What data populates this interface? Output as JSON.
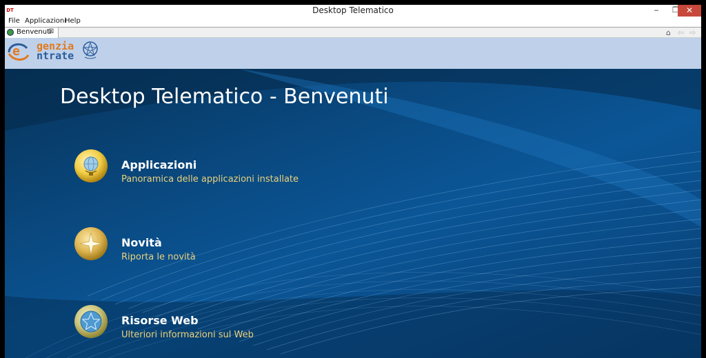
{
  "window": {
    "app_icon": "DT",
    "title": "Desktop Telematico",
    "minimize_icon": "minimize-icon",
    "maximize_icon": "restore-icon",
    "close_icon": "close-icon"
  },
  "menu": {
    "items": [
      "File",
      "Applicazioni",
      "Help"
    ]
  },
  "tab": {
    "label": "Benvenuti",
    "close_glyph": "⊠"
  },
  "nav": {
    "home_icon": "home-icon",
    "back_icon": "back-arrow-icon",
    "forward_icon": "forward-arrow-icon"
  },
  "logo": {
    "line1": "genzia",
    "line2": "ntrate",
    "brand_color": "#e2791e",
    "secondary_color": "#2c5d9b"
  },
  "page": {
    "title": "Desktop Telematico - Benvenuti"
  },
  "entries": [
    {
      "title": "Applicazioni",
      "description": "Panoramica delle applicazioni installate",
      "icon": "globe-icon"
    },
    {
      "title": "Novità",
      "description": "Riporta le novità",
      "icon": "star-icon"
    },
    {
      "title": "Risorse Web",
      "description": "Ulteriori informazioni sul Web",
      "icon": "web-icon"
    }
  ],
  "colors": {
    "content_bg": "#0a4a82",
    "description_text": "#ebd27a",
    "logo_band": "#bfd1ea",
    "close_button": "#c7493c"
  }
}
